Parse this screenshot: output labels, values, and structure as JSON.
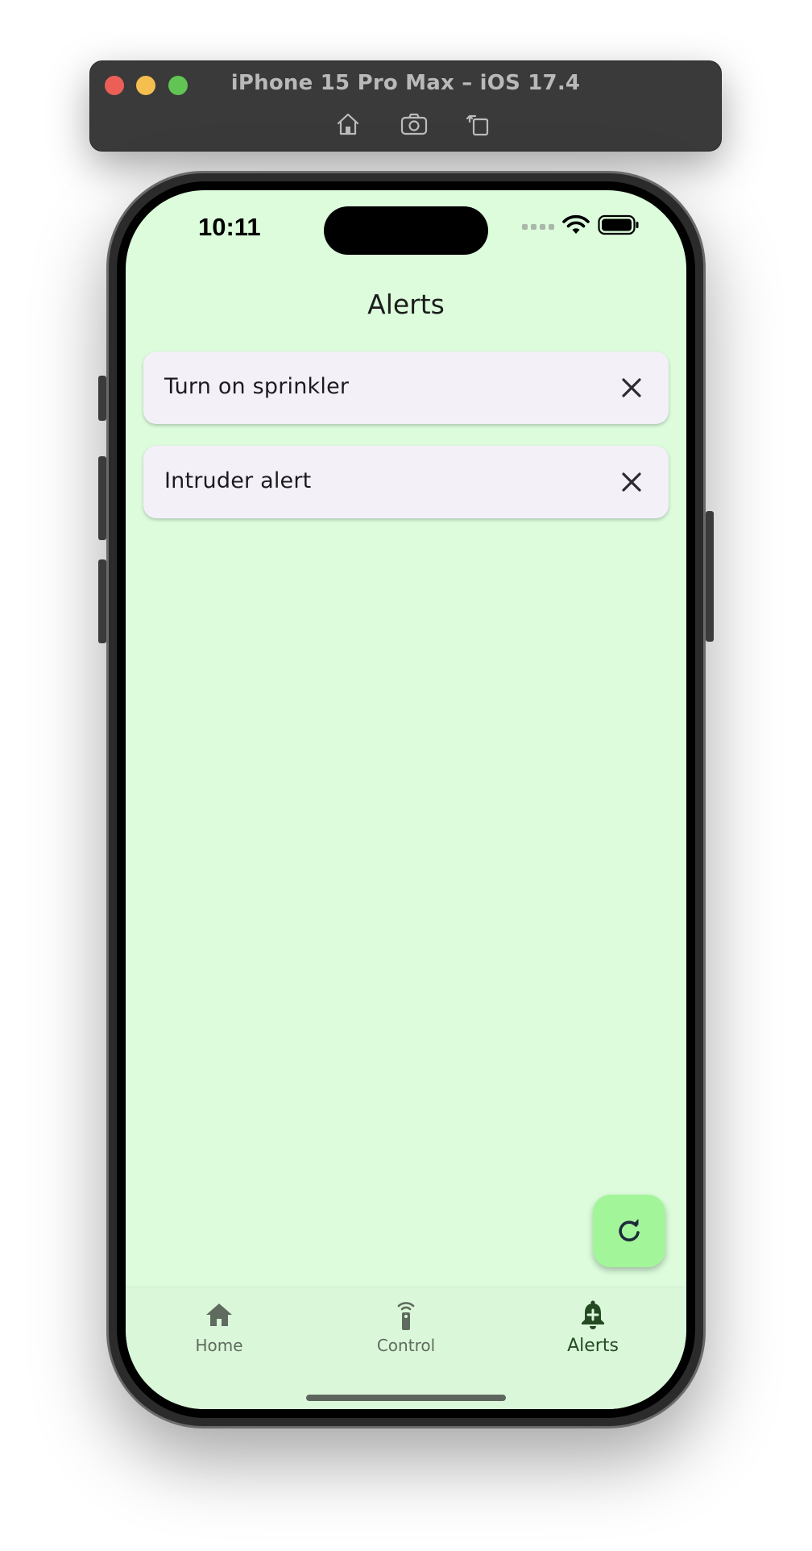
{
  "simulator": {
    "title": "iPhone 15 Pro Max – iOS 17.4",
    "tools": [
      {
        "icon": "home-icon"
      },
      {
        "icon": "screenshot-camera-icon"
      },
      {
        "icon": "rotate-icon"
      }
    ]
  },
  "status_bar": {
    "time": "10:11",
    "icons": [
      "signal-dots-icon",
      "wifi-icon",
      "battery-icon"
    ]
  },
  "app_bar": {
    "title": "Alerts"
  },
  "alerts": [
    {
      "label": "Turn on sprinkler",
      "dismiss_icon": "close-icon"
    },
    {
      "label": "Intruder alert",
      "dismiss_icon": "close-icon"
    }
  ],
  "fab": {
    "icon": "refresh-icon",
    "color": "#a3f59a"
  },
  "bottom_nav": {
    "items": [
      {
        "label": "Home",
        "icon": "home-icon",
        "active": false
      },
      {
        "label": "Control",
        "icon": "remote-control-icon",
        "active": false
      },
      {
        "label": "Alerts",
        "icon": "notification-add-icon",
        "active": true
      }
    ]
  },
  "colors": {
    "screen_background": "#dcfcdc",
    "card_background": "#f3f0f8",
    "active_nav": "#244a22",
    "inactive_nav": "#5f6b5f"
  }
}
